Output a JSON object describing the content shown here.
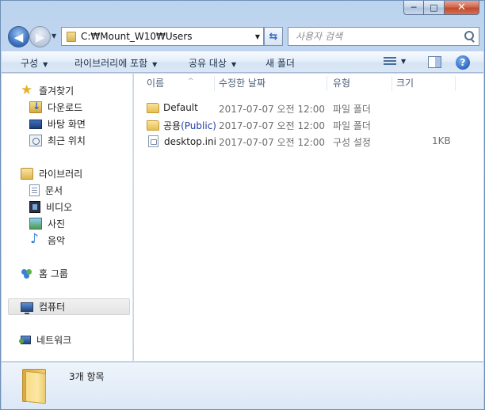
{
  "window": {
    "caption_buttons": {
      "minimize": "─",
      "maximize": "□",
      "close": "✕"
    }
  },
  "navigation": {
    "back_icon": "back-arrow-icon",
    "back_glyph": "◀",
    "forward_glyph": "▶",
    "recent_glyph": "▼",
    "address": "C:₩Mount_W10₩Users",
    "address_dropdown_glyph": "▼",
    "refresh_glyph": "⇆",
    "search_placeholder": "사용자 검색"
  },
  "toolbar": {
    "organize": "구성",
    "include_in_library": "라이브러리에 포함",
    "share_with": "공유 대상",
    "new_folder": "새 폴더",
    "dropdown_glyph": "▼",
    "help_glyph": "?"
  },
  "sidebar": {
    "favorites": {
      "label": "즐겨찾기",
      "items": [
        {
          "label": "다운로드",
          "icon": "download-icon"
        },
        {
          "label": "바탕 화면",
          "icon": "desktop-icon"
        },
        {
          "label": "최근 위치",
          "icon": "recent-places-icon"
        }
      ]
    },
    "libraries": {
      "label": "라이브러리",
      "items": [
        {
          "label": "문서",
          "icon": "documents-icon"
        },
        {
          "label": "비디오",
          "icon": "video-icon"
        },
        {
          "label": "사진",
          "icon": "pictures-icon"
        },
        {
          "label": "음악",
          "icon": "music-icon"
        }
      ]
    },
    "homegroup": {
      "label": "홈 그룹"
    },
    "computer": {
      "label": "컴퓨터",
      "selected": true
    },
    "network": {
      "label": "네트워크"
    }
  },
  "file_list": {
    "columns": [
      "이름",
      "수정한 날짜",
      "유형",
      "크기"
    ],
    "sort_glyph": "^",
    "rows": [
      {
        "name": "Default",
        "name_suffix": "",
        "modified": "2017-07-07 오전 12:00",
        "type": "파일 폴더",
        "size": "",
        "icon": "folder-icon"
      },
      {
        "name": "공용",
        "name_suffix": "(Public)",
        "modified": "2017-07-07 오전 12:00",
        "type": "파일 폴더",
        "size": "",
        "icon": "folder-icon"
      },
      {
        "name": "desktop.ini",
        "name_suffix": "",
        "modified": "2017-07-07 오전 12:00",
        "type": "구성 설정",
        "size": "1KB",
        "icon": "config-file-icon"
      }
    ]
  },
  "details": {
    "item_count": "3개 항목"
  },
  "colors": {
    "window_frame": "#bcd3ee",
    "accent_blue": "#2f69c2",
    "folder_yellow": "#e7bf53"
  }
}
